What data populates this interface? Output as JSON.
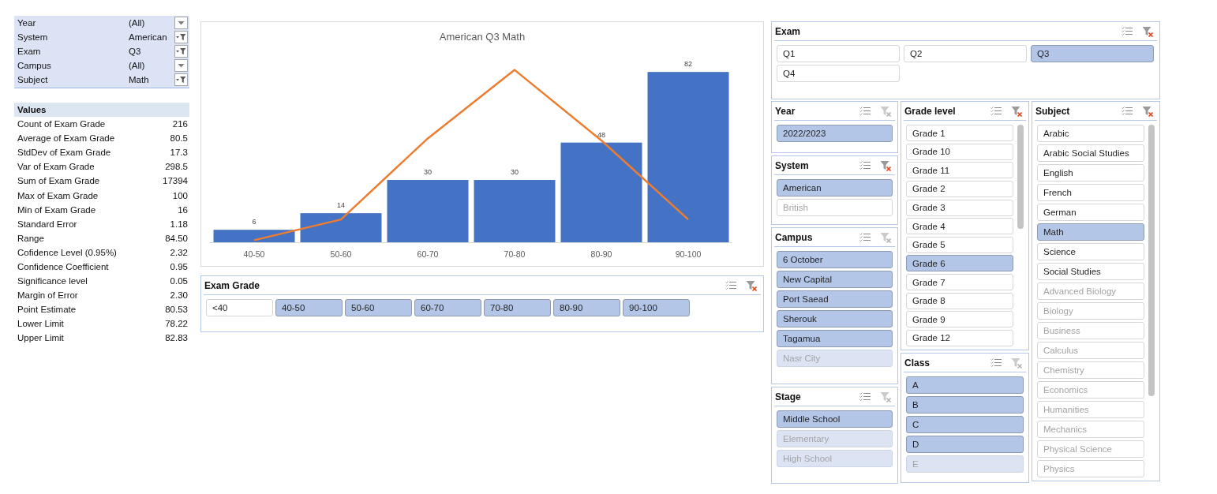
{
  "pivot_filters": [
    {
      "field": "Year",
      "value": "(All)",
      "filtered": false
    },
    {
      "field": "System",
      "value": "American",
      "filtered": true
    },
    {
      "field": "Exam",
      "value": "Q3",
      "filtered": true
    },
    {
      "field": "Campus",
      "value": "(All)",
      "filtered": false
    },
    {
      "field": "Subject",
      "value": "Math",
      "filtered": true
    }
  ],
  "values_table": {
    "header": "Values",
    "rows": [
      {
        "label": "Count of Exam Grade",
        "value": "216"
      },
      {
        "label": "Average of Exam Grade",
        "value": "80.5"
      },
      {
        "label": "StdDev of Exam Grade",
        "value": "17.3"
      },
      {
        "label": "Var of Exam Grade",
        "value": "298.5"
      },
      {
        "label": "Sum of Exam Grade",
        "value": "17394"
      },
      {
        "label": "Max of Exam Grade",
        "value": "100"
      },
      {
        "label": "Min of Exam Grade",
        "value": "16"
      },
      {
        "label": "Standard Error",
        "value": "1.18"
      },
      {
        "label": "Range",
        "value": "84.50"
      },
      {
        "label": "Cofidence Level (0.95%)",
        "value": "2.32"
      },
      {
        "label": "Confidence Coefficient",
        "value": "0.95"
      },
      {
        "label": "Significance level",
        "value": "0.05"
      },
      {
        "label": "Margin of Error",
        "value": "2.30"
      },
      {
        "label": "Point Estimate",
        "value": "80.53"
      },
      {
        "label": "Lower Limit",
        "value": "78.22"
      },
      {
        "label": "Upper Limit",
        "value": "82.83"
      }
    ]
  },
  "chart": {
    "chart_data": {
      "type": "bar",
      "title": "American Q3 Math",
      "categories": [
        "40-50",
        "50-60",
        "60-70",
        "70-80",
        "80-90",
        "90-100"
      ],
      "series": [
        {
          "type": "bar",
          "color": "#4472c4",
          "values": [
            6,
            14,
            30,
            30,
            48,
            82
          ],
          "data_labels": true
        },
        {
          "type": "line",
          "color": "#ed7d31",
          "values": [
            1,
            11,
            50,
            83,
            49,
            11
          ],
          "data_labels": false
        }
      ]
    }
  },
  "exam_grade_slicer": {
    "title": "Exam Grade",
    "filtered": true,
    "items": [
      {
        "label": "<40",
        "selected": false,
        "disabled": false
      },
      {
        "label": "40-50",
        "selected": true,
        "disabled": false
      },
      {
        "label": "50-60",
        "selected": true,
        "disabled": false
      },
      {
        "label": "60-70",
        "selected": true,
        "disabled": false
      },
      {
        "label": "70-80",
        "selected": true,
        "disabled": false
      },
      {
        "label": "80-90",
        "selected": true,
        "disabled": false
      },
      {
        "label": "90-100",
        "selected": true,
        "disabled": false
      }
    ]
  },
  "exam_slicer": {
    "title": "Exam",
    "filtered": true,
    "items": [
      {
        "label": "Q1",
        "selected": false,
        "disabled": false
      },
      {
        "label": "Q2",
        "selected": false,
        "disabled": false
      },
      {
        "label": "Q3",
        "selected": true,
        "disabled": false
      },
      {
        "label": "Q4",
        "selected": false,
        "disabled": false
      }
    ]
  },
  "slicer_columns": [
    {
      "slicers": [
        {
          "title": "Year",
          "filtered": false,
          "scrollable": false,
          "items": [
            {
              "label": "2022/2023",
              "selected": true,
              "disabled": false
            }
          ]
        },
        {
          "title": "System",
          "filtered": true,
          "scrollable": false,
          "items": [
            {
              "label": "American",
              "selected": true,
              "disabled": false
            },
            {
              "label": "British",
              "selected": false,
              "disabled": true
            }
          ]
        },
        {
          "title": "Campus",
          "filtered": false,
          "scrollable": false,
          "items": [
            {
              "label": "6 October",
              "selected": true,
              "disabled": false
            },
            {
              "label": "New Capital",
              "selected": true,
              "disabled": false
            },
            {
              "label": "Port Saead",
              "selected": true,
              "disabled": false
            },
            {
              "label": "Sherouk",
              "selected": true,
              "disabled": false
            },
            {
              "label": "Tagamua",
              "selected": true,
              "disabled": false
            },
            {
              "label": "Nasr City",
              "selected": true,
              "disabled": true
            }
          ]
        },
        {
          "title": "Stage",
          "filtered": false,
          "scrollable": false,
          "items": [
            {
              "label": "Middle School",
              "selected": true,
              "disabled": false
            },
            {
              "label": "Elementary",
              "selected": true,
              "disabled": true
            },
            {
              "label": "High School",
              "selected": true,
              "disabled": true
            }
          ]
        }
      ]
    },
    {
      "slicers": [
        {
          "title": "Grade level",
          "filtered": true,
          "scrollable": true,
          "items": [
            {
              "label": "Grade 1",
              "selected": false,
              "disabled": false
            },
            {
              "label": "Grade 10",
              "selected": false,
              "disabled": false
            },
            {
              "label": "Grade 11",
              "selected": false,
              "disabled": false
            },
            {
              "label": "Grade 2",
              "selected": false,
              "disabled": false
            },
            {
              "label": "Grade 3",
              "selected": false,
              "disabled": false
            },
            {
              "label": "Grade 4",
              "selected": false,
              "disabled": false
            },
            {
              "label": "Grade 5",
              "selected": false,
              "disabled": false
            },
            {
              "label": "Grade 6",
              "selected": true,
              "disabled": false
            },
            {
              "label": "Grade 7",
              "selected": false,
              "disabled": false
            },
            {
              "label": "Grade 8",
              "selected": false,
              "disabled": false
            },
            {
              "label": "Grade 9",
              "selected": false,
              "disabled": false
            },
            {
              "label": "Grade 12",
              "selected": false,
              "disabled": false
            }
          ]
        },
        {
          "title": "Class",
          "filtered": false,
          "scrollable": false,
          "items": [
            {
              "label": "A",
              "selected": true,
              "disabled": false
            },
            {
              "label": "B",
              "selected": true,
              "disabled": false
            },
            {
              "label": "C",
              "selected": true,
              "disabled": false
            },
            {
              "label": "D",
              "selected": true,
              "disabled": false
            },
            {
              "label": "E",
              "selected": true,
              "disabled": true
            }
          ]
        }
      ]
    },
    {
      "slicers": [
        {
          "title": "Subject",
          "filtered": true,
          "scrollable": true,
          "items": [
            {
              "label": "Arabic",
              "selected": false,
              "disabled": false
            },
            {
              "label": "Arabic Social Studies",
              "selected": false,
              "disabled": false
            },
            {
              "label": "English",
              "selected": false,
              "disabled": false
            },
            {
              "label": "French",
              "selected": false,
              "disabled": false
            },
            {
              "label": "German",
              "selected": false,
              "disabled": false
            },
            {
              "label": "Math",
              "selected": true,
              "disabled": false
            },
            {
              "label": "Science",
              "selected": false,
              "disabled": false
            },
            {
              "label": "Social Studies",
              "selected": false,
              "disabled": false
            },
            {
              "label": "Advanced Biology",
              "selected": false,
              "disabled": true
            },
            {
              "label": "Biology",
              "selected": false,
              "disabled": true
            },
            {
              "label": "Business",
              "selected": false,
              "disabled": true
            },
            {
              "label": "Calculus",
              "selected": false,
              "disabled": true
            },
            {
              "label": "Chemistry",
              "selected": false,
              "disabled": true
            },
            {
              "label": "Economics",
              "selected": false,
              "disabled": true
            },
            {
              "label": "Humanities",
              "selected": false,
              "disabled": true
            },
            {
              "label": "Mechanics",
              "selected": false,
              "disabled": true
            },
            {
              "label": "Physical Science",
              "selected": false,
              "disabled": true
            },
            {
              "label": "Physics",
              "selected": false,
              "disabled": true
            }
          ]
        }
      ]
    }
  ]
}
